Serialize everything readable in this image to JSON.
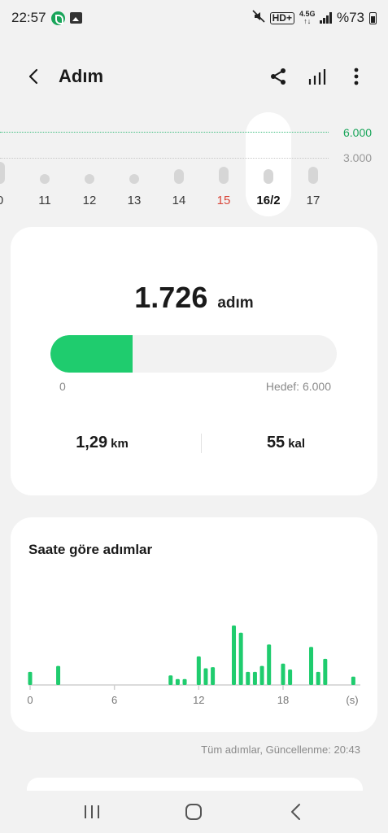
{
  "status_bar": {
    "time": "22:57",
    "network": "4,5G",
    "battery": "%73"
  },
  "header": {
    "title": "Adım",
    "icons": [
      "back-arrow-icon",
      "share-icon",
      "bar-chart-icon",
      "more-vert-icon"
    ]
  },
  "week": {
    "goal_label": "6.000",
    "mid_label": "3.000",
    "days": [
      {
        "label": "0",
        "value": 2500,
        "sunday": false,
        "selected": false
      },
      {
        "label": "11",
        "value": 600,
        "sunday": false,
        "selected": false
      },
      {
        "label": "12",
        "value": 600,
        "sunday": false,
        "selected": false
      },
      {
        "label": "13",
        "value": 600,
        "sunday": false,
        "selected": false
      },
      {
        "label": "14",
        "value": 1700,
        "sunday": false,
        "selected": false
      },
      {
        "label": "15",
        "value": 2000,
        "sunday": true,
        "selected": false
      },
      {
        "label": "16/2",
        "value": 1726,
        "sunday": false,
        "selected": true
      },
      {
        "label": "17",
        "value": 2000,
        "sunday": false,
        "selected": false
      }
    ]
  },
  "summary": {
    "steps": "1.726",
    "steps_unit": "adım",
    "progress_fraction": 0.288,
    "progress_start": "0",
    "goal_text": "Hedef: 6.000",
    "distance": "1,29",
    "distance_unit": "km",
    "calories": "55",
    "calories_unit": "kal"
  },
  "hourly": {
    "title": "Saate göre adımlar",
    "footer": "Tüm adımlar, Güncellenme: 20:43"
  },
  "chart_data": {
    "type": "bar",
    "title": "Saate göre adımlar",
    "xlabel": "(s)",
    "x_ticks": [
      "0",
      "6",
      "12",
      "18",
      "(s)"
    ],
    "xlim": [
      0,
      23.5
    ],
    "ylim": [
      0,
      260
    ],
    "grid": false,
    "bars": [
      {
        "x": 0,
        "y": 55
      },
      {
        "x": 2,
        "y": 80
      },
      {
        "x": 10,
        "y": 40
      },
      {
        "x": 10.5,
        "y": 25
      },
      {
        "x": 11,
        "y": 25
      },
      {
        "x": 12,
        "y": 120
      },
      {
        "x": 12.5,
        "y": 70
      },
      {
        "x": 13,
        "y": 75
      },
      {
        "x": 14.5,
        "y": 250
      },
      {
        "x": 15,
        "y": 220
      },
      {
        "x": 15.5,
        "y": 55
      },
      {
        "x": 16,
        "y": 55
      },
      {
        "x": 16.5,
        "y": 80
      },
      {
        "x": 17,
        "y": 170
      },
      {
        "x": 18,
        "y": 90
      },
      {
        "x": 18.5,
        "y": 65
      },
      {
        "x": 20,
        "y": 160
      },
      {
        "x": 20.5,
        "y": 55
      },
      {
        "x": 21,
        "y": 110
      },
      {
        "x": 23,
        "y": 35
      }
    ],
    "colors": {
      "bar": "#1fcc6e",
      "axis": "#cfcfcf"
    }
  },
  "nav": {
    "icons": [
      "recents-icon",
      "home-icon",
      "back-nav-icon"
    ]
  }
}
